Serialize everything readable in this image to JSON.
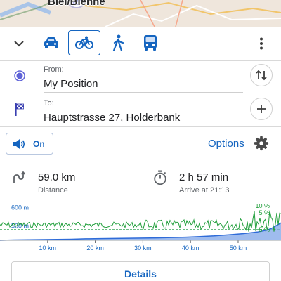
{
  "map": {
    "place_label": "Biel/Bienne"
  },
  "modes": {
    "collapse_icon": "chevron-down-icon",
    "items": [
      {
        "icon": "car-icon",
        "active": false
      },
      {
        "icon": "bicycle-icon",
        "active": true
      },
      {
        "icon": "pedestrian-icon",
        "active": false
      },
      {
        "icon": "bus-icon",
        "active": false
      }
    ],
    "more_icon": "more-vert-icon"
  },
  "route": {
    "from_label": "From:",
    "from_value": "My Position",
    "to_label": "To:",
    "to_value": "Hauptstrasse 27, Holderbank"
  },
  "sound": {
    "label": "On",
    "icon": "speaker-icon"
  },
  "options_label": "Options",
  "summary": {
    "distance_value": "59.0 km",
    "distance_label": "Distance",
    "time_value": "2 h 57 min",
    "time_label": "Arrive at 21:13"
  },
  "chart_data": {
    "type": "area",
    "title": "",
    "xlabel": "",
    "ylabel": "",
    "x_unit": "km",
    "x_ticks": [
      "10 km",
      "20 km",
      "30 km",
      "40 km",
      "50 km"
    ],
    "x_range": [
      0,
      59
    ],
    "y_ticks": [
      "600 m",
      "500 m"
    ],
    "y_range": [
      440,
      640
    ],
    "slope_ticks": [
      "10 %",
      "5 %",
      "5 %"
    ],
    "series": [
      {
        "x": [
          0,
          3,
          6,
          9,
          12,
          15,
          18,
          21,
          24,
          27,
          30,
          33,
          36,
          39,
          42,
          45,
          48,
          51,
          54,
          56,
          57,
          58,
          59
        ],
        "values": [
          440,
          442,
          443,
          444,
          445,
          446,
          448,
          449,
          450,
          451,
          452,
          453,
          455,
          457,
          460,
          464,
          470,
          476,
          485,
          495,
          505,
          520,
          535
        ]
      }
    ],
    "colors": {
      "elevation": "#2e6bd8",
      "elevation_fill": "#7fa6e8",
      "slope": "#1f9e3a"
    }
  },
  "details_label": "Details",
  "colors": {
    "accent": "#1565c0",
    "location_dot": "#5f63d8"
  }
}
